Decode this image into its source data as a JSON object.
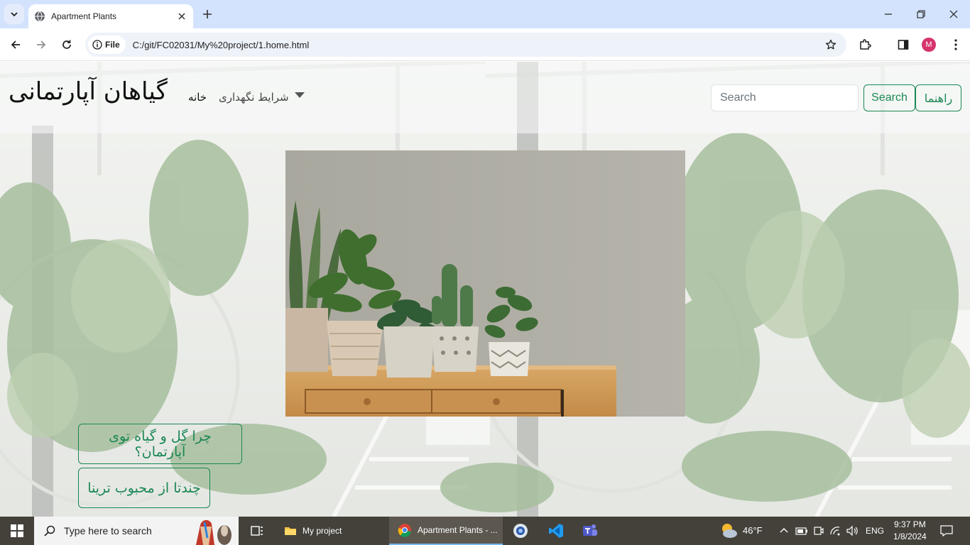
{
  "browser": {
    "tab_title": "Apartment Plants",
    "site_chip": "File",
    "url": "C:/git/FC02031/My%20project/1.home.html",
    "profile_initial": "M"
  },
  "page": {
    "brand": "گیاهان آپارتمانی",
    "nav": {
      "home": "خانه",
      "care": "شرایط نگهداری"
    },
    "search": {
      "placeholder": "Search",
      "button": "Search"
    },
    "guide_button": "راهنما",
    "hero_image": "potted-plants-on-shelf",
    "buttons": {
      "why_plants": "چرا گل و گیاه توی آپارتمان؟",
      "favorites": "چندتا از محبوب ترینا"
    }
  },
  "taskbar": {
    "search_placeholder": "Type here to search",
    "apps": [
      {
        "label": "My project",
        "icon": "folder-icon"
      },
      {
        "label": "Apartment Plants - ...",
        "icon": "chrome-icon"
      }
    ],
    "weather": "46°F",
    "language": "ENG",
    "time": "9:37 PM",
    "date": "1/8/2024"
  },
  "colors": {
    "tab_strip": "#d3e3fd",
    "success": "#198754",
    "taskbar": "#44413b"
  }
}
